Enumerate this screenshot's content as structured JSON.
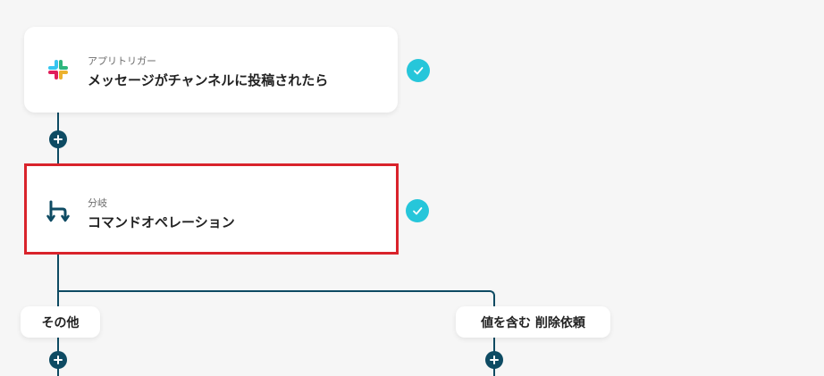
{
  "trigger_card": {
    "subtitle": "アプリトリガー",
    "title": "メッセージがチャンネルに投稿されたら",
    "icon": "slack-icon",
    "status": "completed"
  },
  "branch_card": {
    "subtitle": "分岐",
    "title": "コマンドオペレーション",
    "icon": "branch-icon",
    "status": "completed",
    "selected": true
  },
  "branches": [
    {
      "label": "その他"
    },
    {
      "label": "値を含む 削除依頼"
    }
  ],
  "colors": {
    "connector": "#0e4b63",
    "check": "#26c6da",
    "highlight": "#d9232b",
    "background": "#f6f6f6"
  }
}
